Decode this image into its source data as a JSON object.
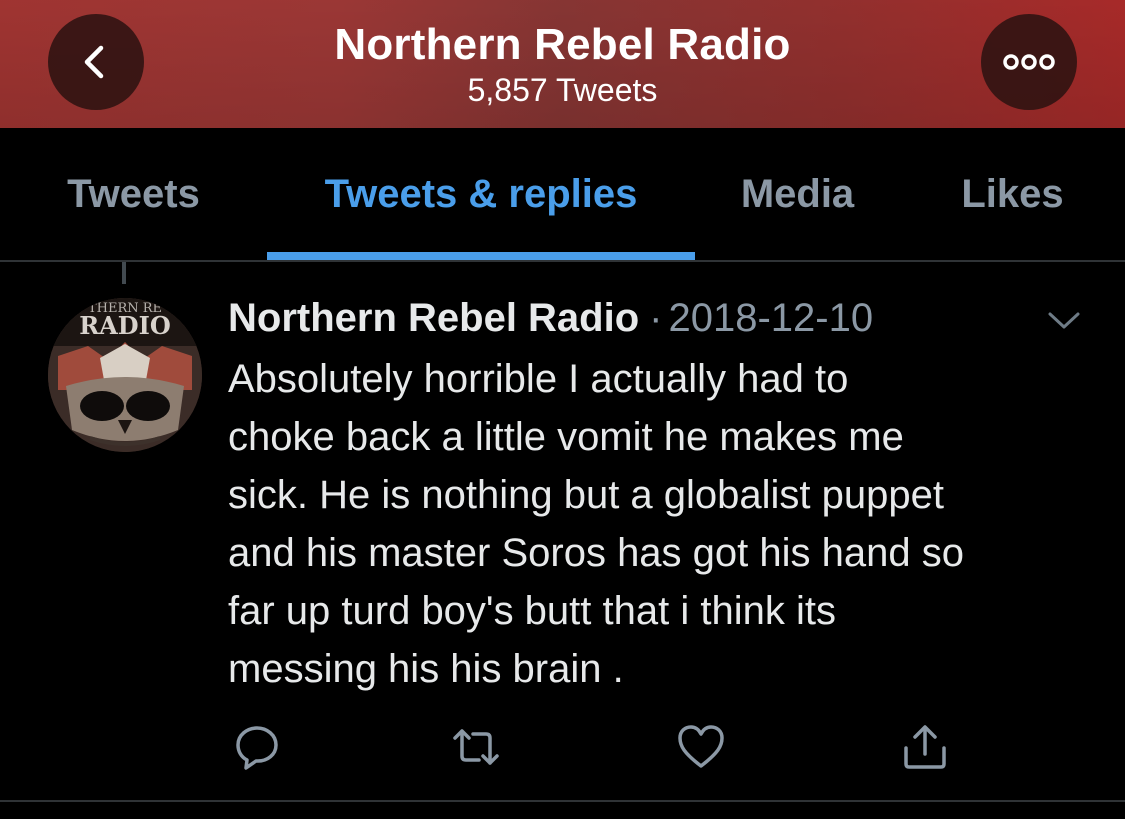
{
  "header": {
    "title": "Northern Rebel Radio",
    "subtitle": "5,857 Tweets",
    "back_icon": "chevron-left-icon",
    "more_icon": "ellipsis-icon",
    "gradient_colors": [
      "#a83734",
      "#b02c2b"
    ]
  },
  "tabs": [
    {
      "label": "Tweets",
      "active": false
    },
    {
      "label": "Tweets & replies",
      "active": true
    },
    {
      "label": "Media",
      "active": false
    },
    {
      "label": "Likes",
      "active": false
    }
  ],
  "tweet": {
    "avatar_text_top": "THERN RE",
    "avatar_text_main": "RADIO",
    "author": "Northern Rebel Radio",
    "separator": "·",
    "date": "2018-12-10",
    "lines": [
      "Absolutely horrible I actually had to",
      "choke back a little vomit he makes me",
      "sick. He is nothing but a globalist puppet",
      "and his master Soros has got his hand so",
      "far up turd boy's butt that i think its",
      "messing his his brain ."
    ],
    "actions": [
      "reply-icon",
      "retweet-icon",
      "like-icon",
      "share-icon"
    ]
  },
  "colors": {
    "accent": "#4a9eea",
    "background": "#000000",
    "text": "#e7e9ea",
    "muted": "#8b98a5"
  }
}
